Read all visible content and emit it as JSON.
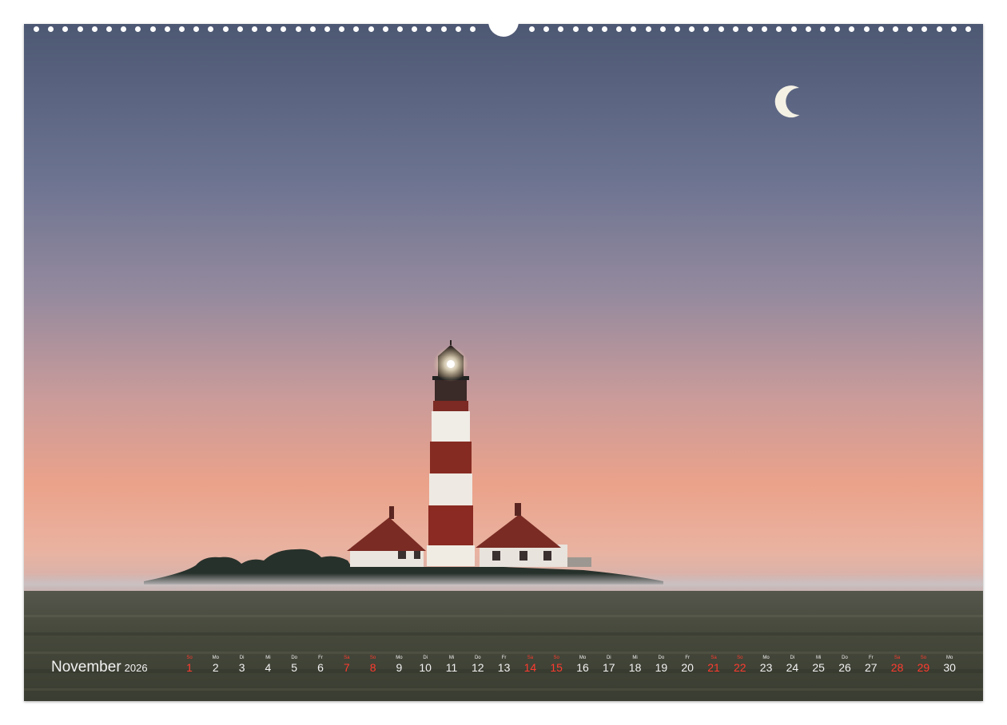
{
  "calendar": {
    "month": "November",
    "year": "2026",
    "weekend_color": "#ff3b2f",
    "text_color": "#f2f2f2",
    "days": [
      {
        "num": "1",
        "wd": "So",
        "weekend": true
      },
      {
        "num": "2",
        "wd": "Mo",
        "weekend": false
      },
      {
        "num": "3",
        "wd": "Di",
        "weekend": false
      },
      {
        "num": "4",
        "wd": "Mi",
        "weekend": false
      },
      {
        "num": "5",
        "wd": "Do",
        "weekend": false
      },
      {
        "num": "6",
        "wd": "Fr",
        "weekend": false
      },
      {
        "num": "7",
        "wd": "Sa",
        "weekend": true
      },
      {
        "num": "8",
        "wd": "So",
        "weekend": true
      },
      {
        "num": "9",
        "wd": "Mo",
        "weekend": false
      },
      {
        "num": "10",
        "wd": "Di",
        "weekend": false
      },
      {
        "num": "11",
        "wd": "Mi",
        "weekend": false
      },
      {
        "num": "12",
        "wd": "Do",
        "weekend": false
      },
      {
        "num": "13",
        "wd": "Fr",
        "weekend": false
      },
      {
        "num": "14",
        "wd": "Sa",
        "weekend": true
      },
      {
        "num": "15",
        "wd": "So",
        "weekend": true
      },
      {
        "num": "16",
        "wd": "Mo",
        "weekend": false
      },
      {
        "num": "17",
        "wd": "Di",
        "weekend": false
      },
      {
        "num": "18",
        "wd": "Mi",
        "weekend": false
      },
      {
        "num": "19",
        "wd": "Do",
        "weekend": false
      },
      {
        "num": "20",
        "wd": "Fr",
        "weekend": false
      },
      {
        "num": "21",
        "wd": "Sa",
        "weekend": true
      },
      {
        "num": "22",
        "wd": "So",
        "weekend": true
      },
      {
        "num": "23",
        "wd": "Mo",
        "weekend": false
      },
      {
        "num": "24",
        "wd": "Di",
        "weekend": false
      },
      {
        "num": "25",
        "wd": "Mi",
        "weekend": false
      },
      {
        "num": "26",
        "wd": "Do",
        "weekend": false
      },
      {
        "num": "27",
        "wd": "Fr",
        "weekend": false
      },
      {
        "num": "28",
        "wd": "Sa",
        "weekend": true
      },
      {
        "num": "29",
        "wd": "So",
        "weekend": true
      },
      {
        "num": "30",
        "wd": "Mo",
        "weekend": false
      }
    ]
  }
}
